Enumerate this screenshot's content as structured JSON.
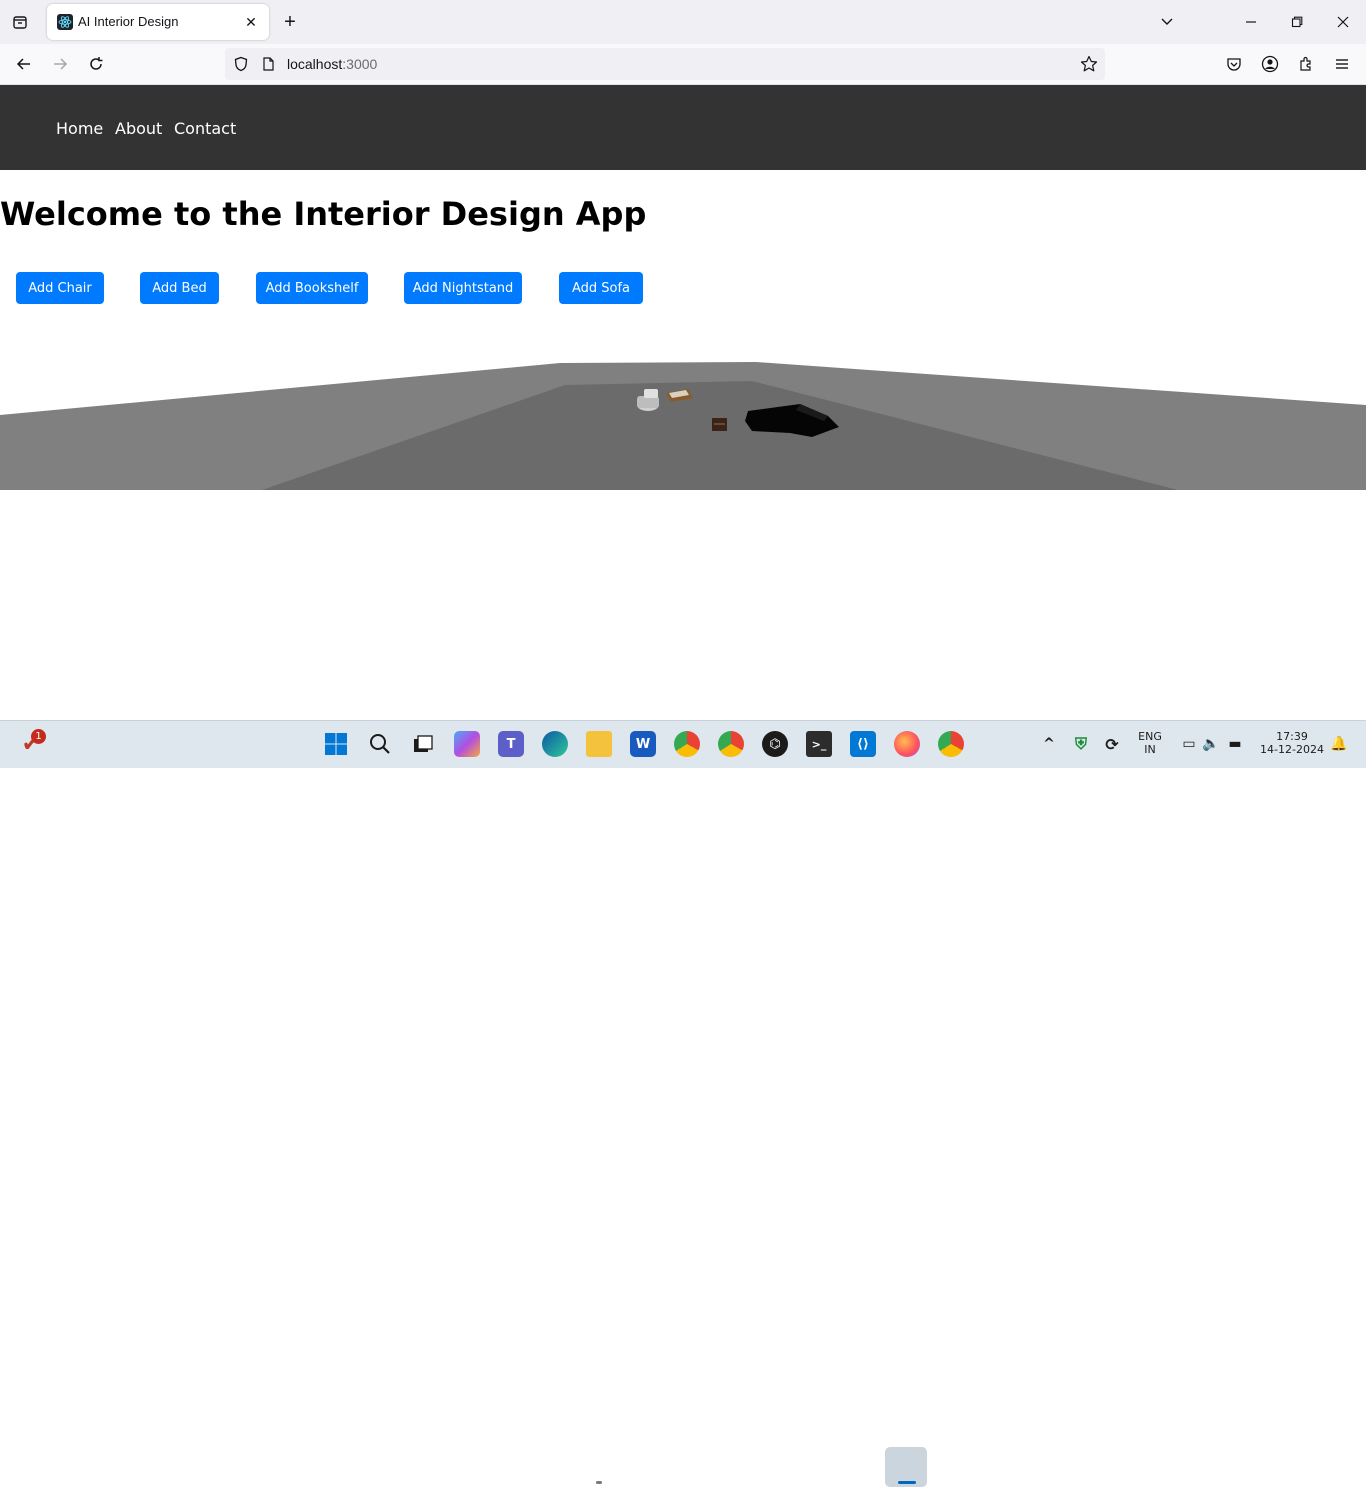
{
  "browser": {
    "tab_title": "AI Interior Design",
    "url_host": "localhost",
    "url_port": ":3000"
  },
  "site": {
    "nav": [
      "Home",
      "About",
      "Contact"
    ],
    "title": "Welcome to the Interior Design App",
    "buttons": [
      "Add Chair",
      "Add Bed",
      "Add Bookshelf",
      "Add Nightstand",
      "Add Sofa"
    ],
    "button_color": "#007bff",
    "nav_bg": "#333333"
  },
  "taskbar": {
    "notification_count": "1",
    "lang_top": "ENG",
    "lang_bottom": "IN",
    "time": "17:39",
    "date": "14-12-2024"
  }
}
